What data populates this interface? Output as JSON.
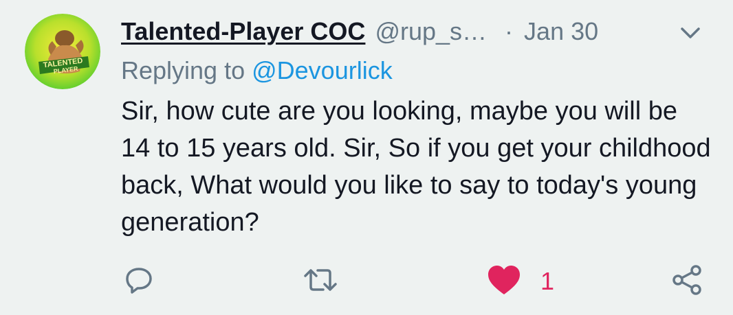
{
  "tweet": {
    "display_name": "Talented-Player COC",
    "handle": "@rup_s…",
    "separator": "·",
    "date": "Jan 30",
    "avatar": {
      "label_line1": "TALENTED",
      "label_line2": "PLAYER"
    },
    "replying_prefix": "Replying to",
    "replying_to": "@Devourlick",
    "text": "Sir, how cute are you looking, maybe you will be 14 to 15 years old. Sir, So if you get your childhood back, What would you like to say to today's young generation?"
  },
  "actions": {
    "reply_icon": "reply-icon",
    "retweet_icon": "retweet-icon",
    "like_icon": "heart-icon",
    "like_count": "1",
    "share_icon": "share-icon"
  },
  "colors": {
    "background": "#eef2f1",
    "text": "#141823",
    "muted": "#657786",
    "link": "#1b95e0",
    "like": "#e0245e",
    "avatar_yellow": "#f3e52a",
    "avatar_green": "#5fd22e"
  }
}
